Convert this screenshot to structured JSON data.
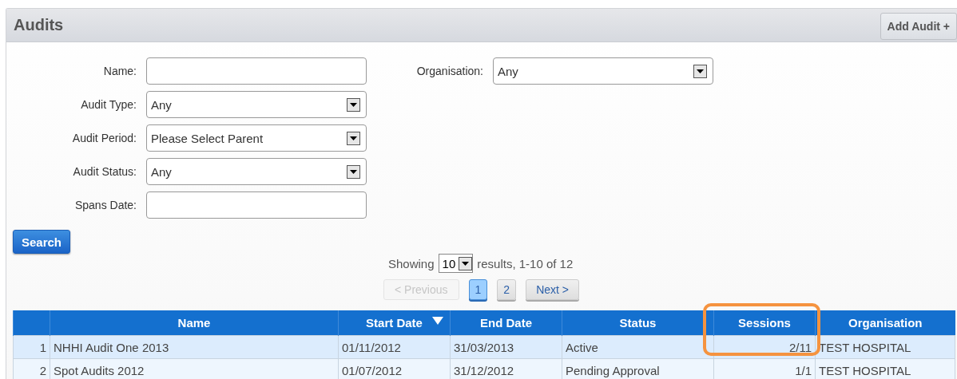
{
  "panel": {
    "title": "Audits",
    "add_button": "Add Audit +"
  },
  "filters": [
    {
      "label": "Name:",
      "kind": "text"
    },
    {
      "label": "Audit Type:",
      "kind": "select",
      "value": "Any"
    },
    {
      "label": "Audit Period:",
      "kind": "select",
      "value": "Please Select Parent"
    },
    {
      "label": "Audit Status:",
      "kind": "select",
      "value": "Any"
    },
    {
      "label": "Spans Date:",
      "kind": "text"
    }
  ],
  "organisation": {
    "label": "Organisation:",
    "value": "Any"
  },
  "search_button": "Search",
  "showing": {
    "prefix": "Showing",
    "page_size": "10",
    "suffix": "results, 1-10 of 12"
  },
  "pagination": {
    "previous": {
      "label": "< Previous",
      "disabled": true
    },
    "pages": [
      {
        "label": "1",
        "selected": true
      },
      {
        "label": "2",
        "selected": false
      }
    ],
    "next": {
      "label": "Next >",
      "disabled": false
    }
  },
  "table": {
    "columns": [
      {
        "sorted": false,
        "highlighted": false
      },
      {
        "label": "Name",
        "sorted": false,
        "highlighted": false
      },
      {
        "label": "Start Date",
        "sorted": true,
        "highlighted": false
      },
      {
        "label": "End Date",
        "sorted": false,
        "highlighted": false
      },
      {
        "label": "Status",
        "sorted": false,
        "highlighted": false
      },
      {
        "label": "Sessions",
        "sorted": false,
        "highlighted": true
      },
      {
        "label": "Organisation",
        "sorted": false,
        "highlighted": false
      }
    ],
    "rows": [
      [
        "1",
        "NHHI Audit One 2013",
        "01/11/2012",
        "31/03/2013",
        "Active",
        "2/11",
        "TEST HOSPITAL"
      ],
      [
        "2",
        "Spot Audits 2012",
        "01/07/2012",
        "31/12/2012",
        "Pending Approval",
        "1/1",
        "TEST HOSPITAL"
      ]
    ]
  }
}
